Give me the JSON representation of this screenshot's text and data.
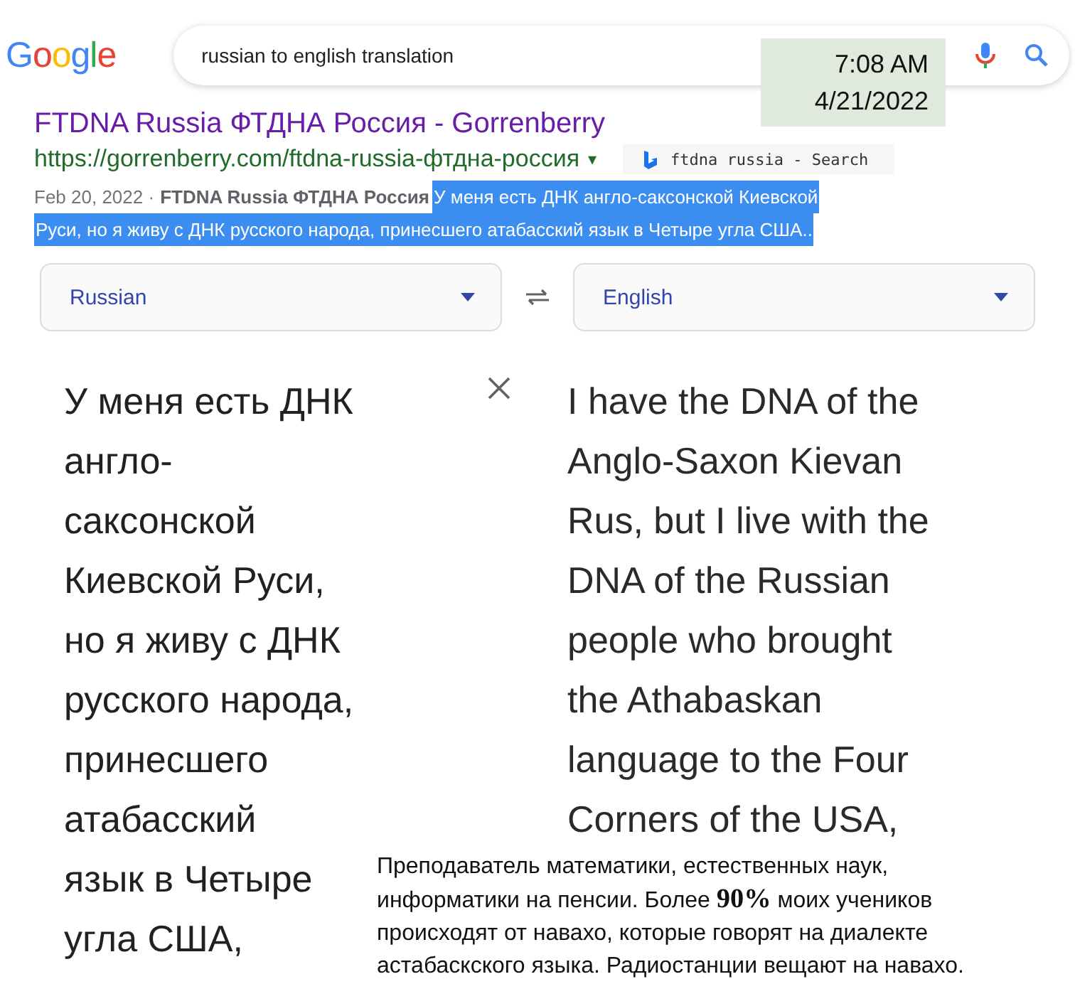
{
  "search": {
    "logo": "Google",
    "query": "russian to english translation"
  },
  "clock": {
    "time": "7:08 AM",
    "date": "4/21/2022"
  },
  "result": {
    "title": "FTDNA Russia ФТДНА Россия - Gorrenberry",
    "url": "https://gorrenberry.com/ftdna-russia-фтдна-россия",
    "url_caret": "▾",
    "tab_label": "ftdna russia - Search",
    "date": "Feb 20, 2022 ·",
    "bold_title": "FTDNA Russia ФТДНА Россия",
    "snippet_lines": [
      {
        "text": "У меня есть ДНК англо-саксонской Киевской",
        "selected": true
      },
      {
        "text": "Руси, но я живу с ДНК русского народа, принесшего атабасский язык в Четыре угла США..",
        "selected": true
      }
    ]
  },
  "translator": {
    "source_language": "Russian",
    "target_language": "English",
    "source_lines": [
      "У меня есть ДНК",
      "англо-",
      "саксонской",
      "Киевской Руси,",
      "но я живу с ДНК",
      "русского народа,",
      "принесшего",
      "атабасский",
      "язык в Четыре",
      "угла США,"
    ],
    "target_lines": [
      "I have the DNA of the",
      "Anglo-Saxon Kievan",
      "Rus, but I live with the",
      "DNA of the Russian",
      "people who brought",
      "the Athabaskan",
      "language to the Four",
      "Corners of the USA,"
    ]
  },
  "caption_lines": [
    "Преподаватель математики, естественных наук,",
    "информатики на пенсии. Более **90%** моих учеников",
    "происходят от навахо, которые говорят на диалекте",
    "астабаскского языка. Радиостанции вещают на навахо."
  ]
}
